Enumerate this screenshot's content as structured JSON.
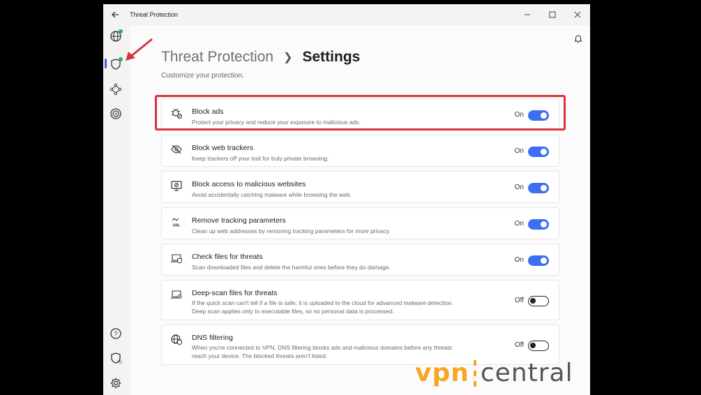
{
  "window": {
    "title": "Threat Protection"
  },
  "header": {
    "parent": "Threat Protection",
    "current": "Settings",
    "subtitle": "Customize your protection."
  },
  "settings": [
    {
      "title": "Block ads",
      "desc": [
        "Protect your privacy and reduce your exposure to malicious ads."
      ],
      "state": "On",
      "icon": "bug-block-icon"
    },
    {
      "title": "Block web trackers",
      "desc": [
        "Keep trackers off your trail for truly private browsing."
      ],
      "state": "On",
      "icon": "eye-off-icon"
    },
    {
      "title": "Block access to malicious websites",
      "desc": [
        "Avoid accidentally catching malware while browsing the web."
      ],
      "state": "On",
      "icon": "monitor-block-icon"
    },
    {
      "title": "Remove tracking parameters",
      "desc": [
        "Clean up web addresses by removing tracking parameters for more privacy."
      ],
      "state": "On",
      "icon": "url-icon"
    },
    {
      "title": "Check files for threats",
      "desc": [
        "Scan downloaded files and delete the harmful ones before they do damage."
      ],
      "state": "On",
      "icon": "laptop-shield-icon"
    },
    {
      "title": "Deep-scan files for threats",
      "desc": [
        "If the quick scan can't tell if a file is safe, it is uploaded to the cloud for advanced malware detection.",
        "Deep scan applies only to executable files, so no personal data is processed."
      ],
      "state": "Off",
      "icon": "laptop-search-icon"
    },
    {
      "title": "DNS filtering",
      "desc": [
        "When you're connected to VPN, DNS filtering blocks ads and malicious domains before any threats",
        "reach your device. The blocked threats aren't listed."
      ],
      "state": "Off",
      "icon": "globe-shield-icon"
    }
  ],
  "sidebar": {
    "badge_value": "70"
  },
  "watermark": {
    "part1": "vpn",
    "part2": "central"
  },
  "colors": {
    "accent": "#3d6ff0",
    "highlight": "#d8343b",
    "status_green": "#23b15a",
    "brand_orange": "#f6a623"
  }
}
